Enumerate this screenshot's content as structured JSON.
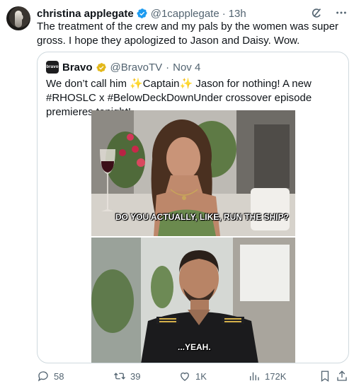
{
  "tweet": {
    "author_name": "christina applegate",
    "author_handle": "@1capplegate",
    "separator": "·",
    "time": "13h",
    "text": "The treatment of the crew and my pals by the women was super gross. I hope they apologized to Jason and Daisy. Wow."
  },
  "top_icons": [
    "grok-icon",
    "more-icon"
  ],
  "quoted": {
    "avatar_text": "bravo",
    "author_name": "Bravo",
    "author_handle": "@BravoTV",
    "separator": "·",
    "date": "Nov 4",
    "text_part1": "We don’t call him ",
    "sparkle": "✨",
    "text_captain": "Captain",
    "text_part2": " Jason for nothing! A new ",
    "hashtag1": "#RHOSLC",
    "text_part3": " x ",
    "hashtag2": "#BelowDeckDownUnder",
    "text_part4": " crossover episode premieres tonight!",
    "media": {
      "subtitle1": "DO YOU ACTUALLY, LIKE, RUN THE SHIP?",
      "subtitle2": "...YEAH."
    }
  },
  "actions": {
    "replies": "58",
    "retweets": "39",
    "likes": "1K",
    "views": "172K"
  },
  "colors": {
    "verified_blue": "#1d9bf0",
    "verified_gold": "#e2b719",
    "text": "#0f1419",
    "secondary": "#536471",
    "border": "#cfd9de"
  }
}
